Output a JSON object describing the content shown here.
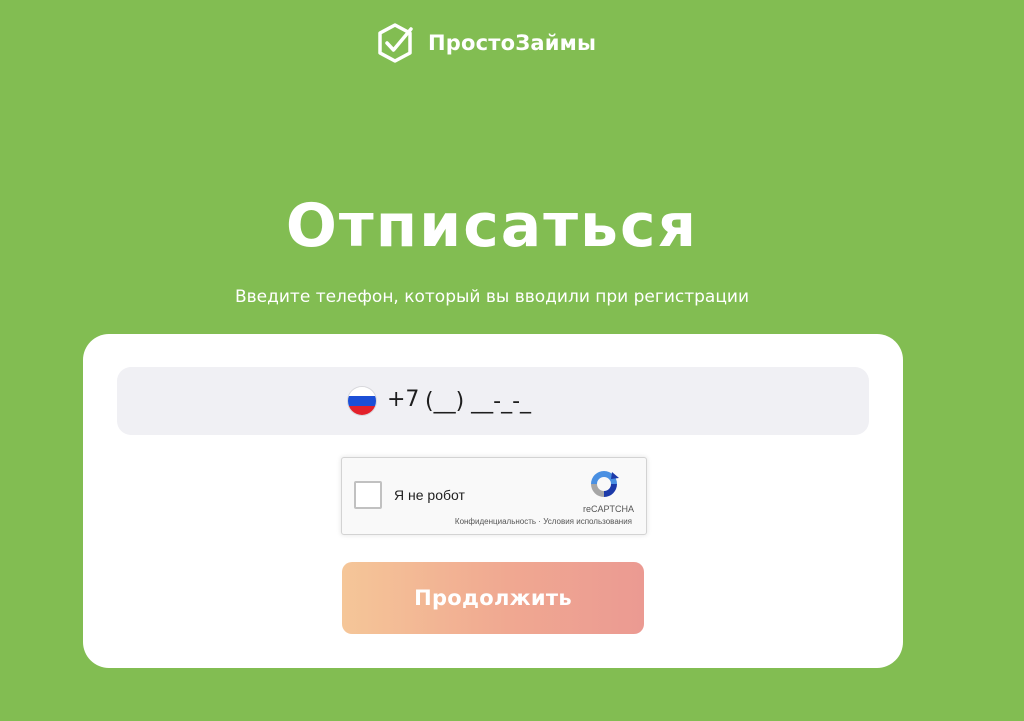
{
  "header": {
    "logo_text": "ПростоЗаймы",
    "logo_icon": "shield-check-icon"
  },
  "main": {
    "title": "Отписаться",
    "subtitle": "Введите телефон, который вы вводили при регистрации"
  },
  "form": {
    "country_flag": "russia-flag-icon",
    "country_code": "+7",
    "phone_placeholder": "(__) __-_-_",
    "phone_value": "",
    "recaptcha": {
      "label": "Я не робот",
      "brand": "reCAPTCHA",
      "privacy_link": "Конфиденциальность",
      "separator": "·",
      "terms_link": "Условия использования",
      "checked": false
    },
    "submit_label": "Продолжить"
  },
  "colors": {
    "background": "#82bd52",
    "card": "#ffffff",
    "input_bg": "#f0f0f4",
    "button_gradient_start": "#f5c698",
    "button_gradient_end": "#eb9a92"
  }
}
